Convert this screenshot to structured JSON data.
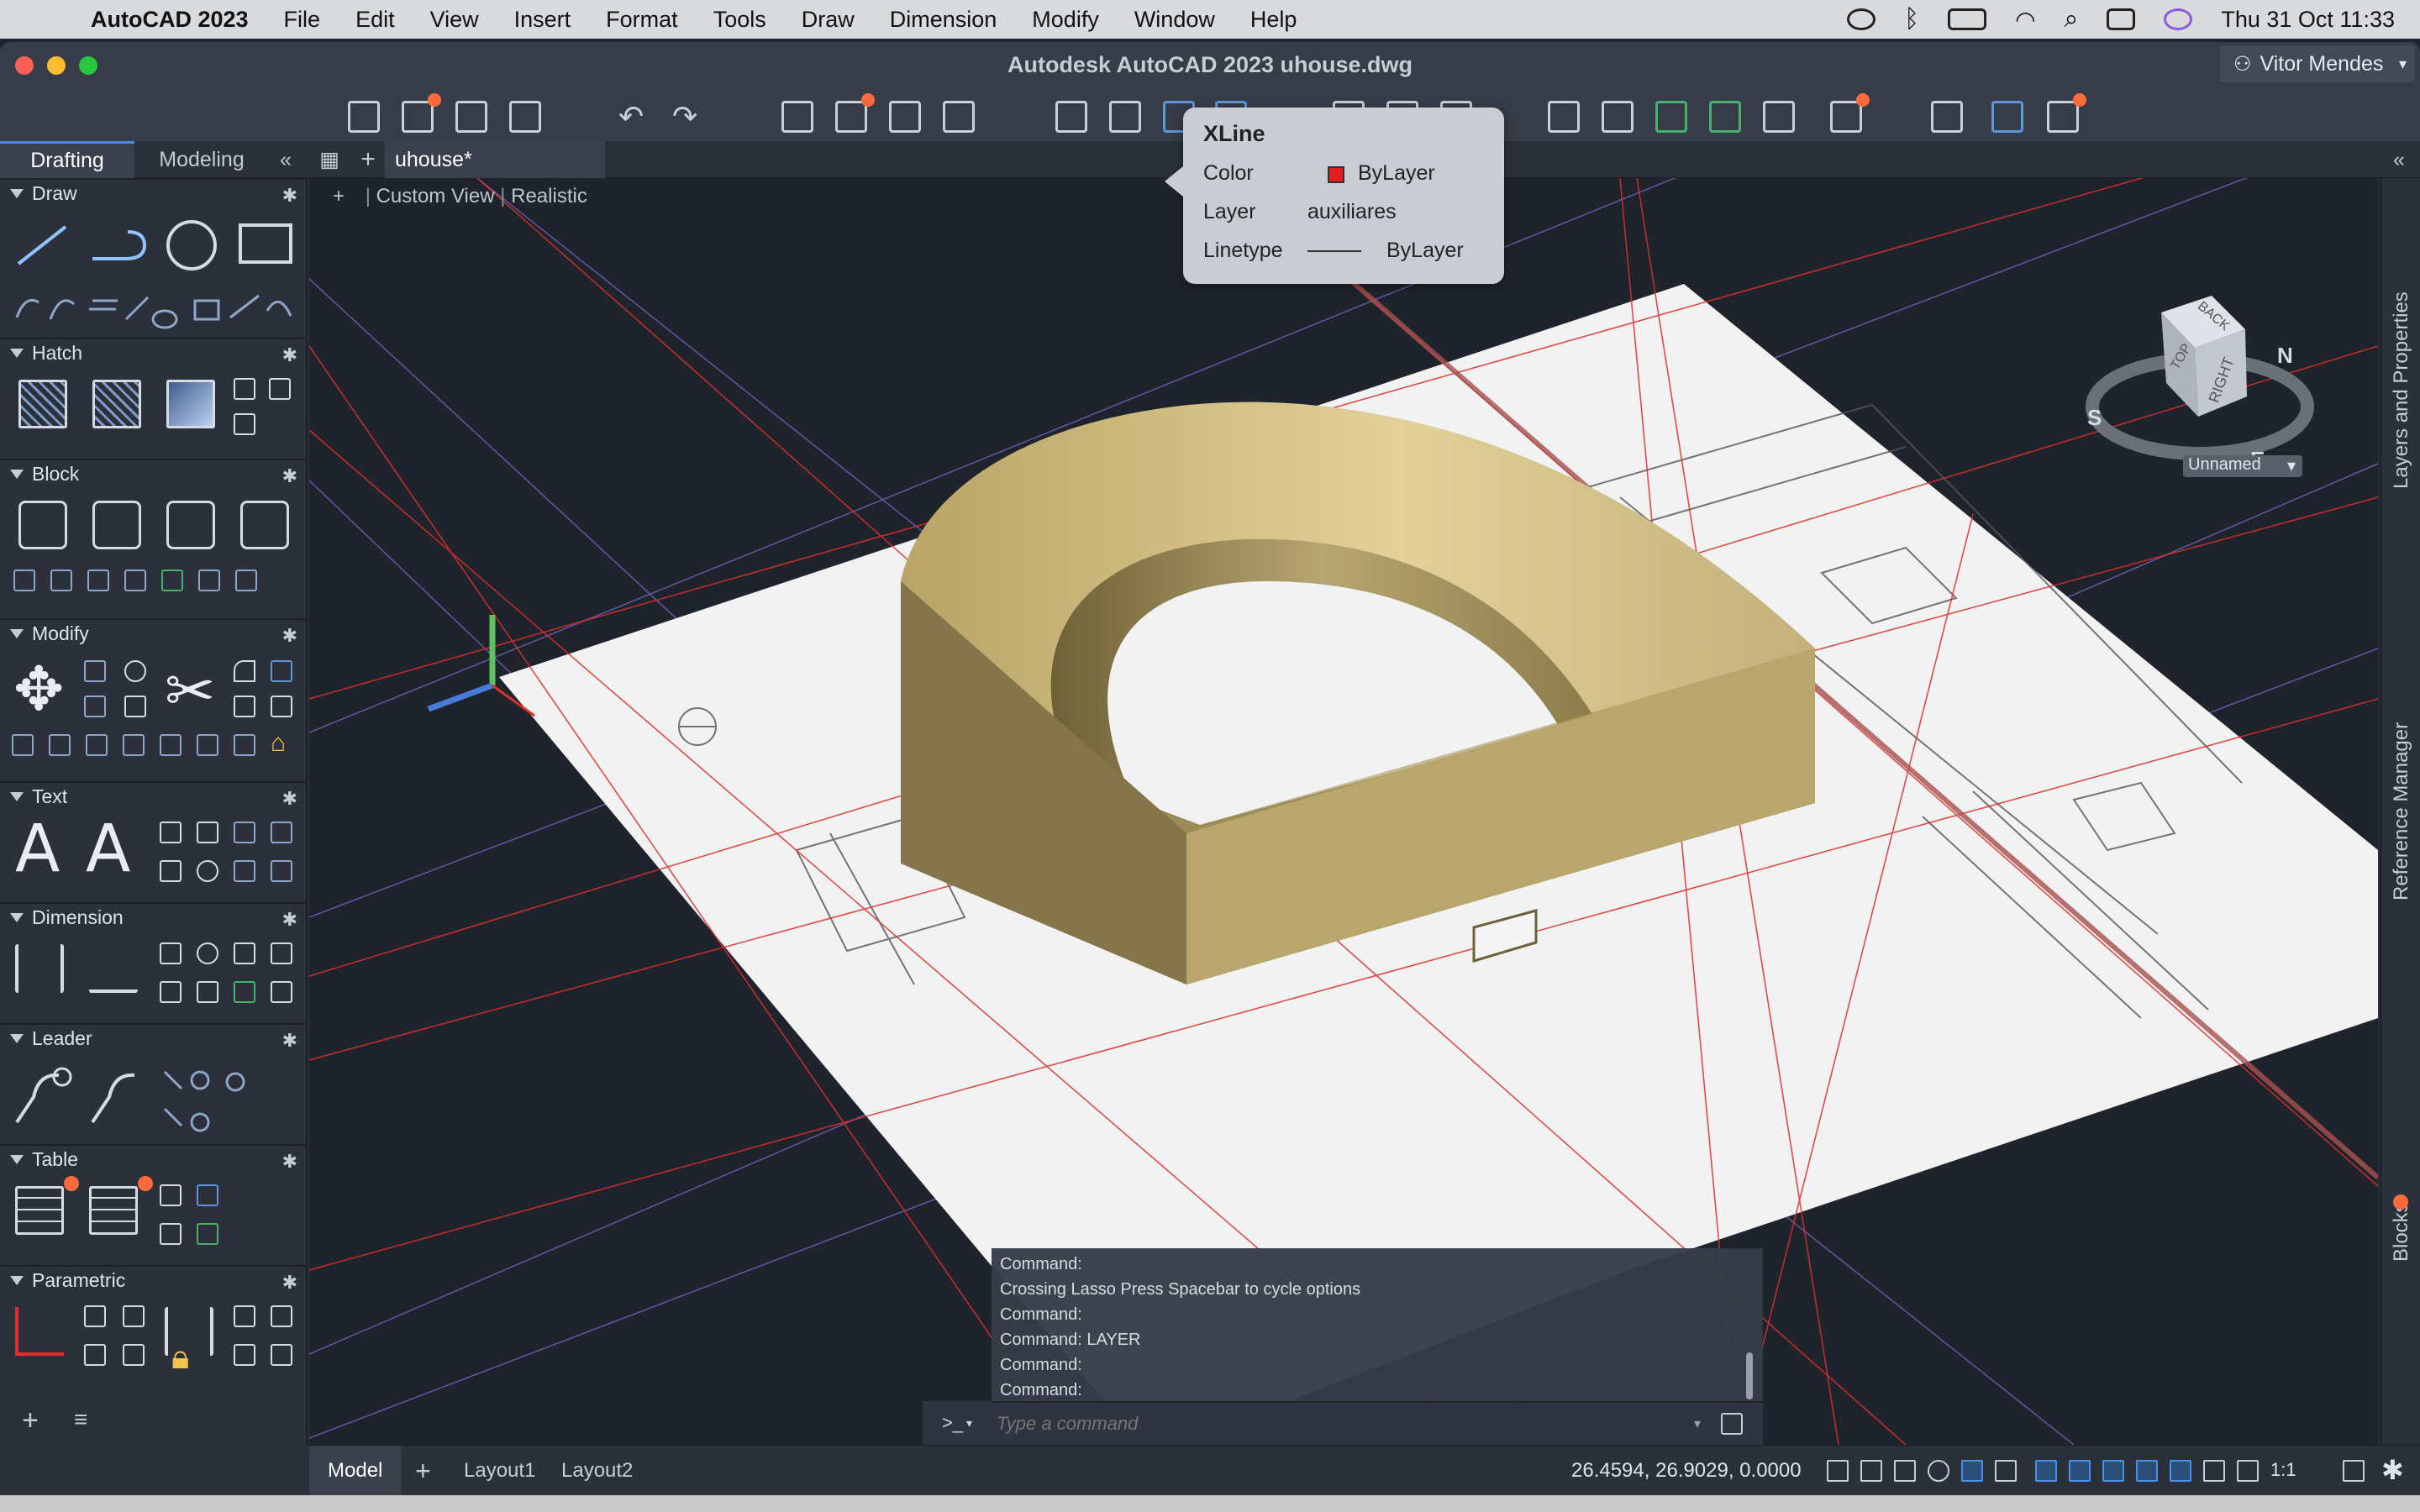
{
  "menubar": {
    "app_name": "AutoCAD 2023",
    "items": [
      "File",
      "Edit",
      "View",
      "Insert",
      "Format",
      "Tools",
      "Draw",
      "Dimension",
      "Modify",
      "Window",
      "Help"
    ],
    "datetime": "Thu 31 Oct  11:33"
  },
  "window": {
    "title": "Autodesk AutoCAD 2023    uhouse.dwg",
    "user": "Vitor Mendes"
  },
  "panel": {
    "tabs": [
      "Drafting",
      "Modeling"
    ],
    "sections": [
      "Draw",
      "Hatch",
      "Block",
      "Modify",
      "Text",
      "Dimension",
      "Leader",
      "Table",
      "Parametric"
    ]
  },
  "document": {
    "tab": "uhouse*"
  },
  "viewport": {
    "view_label": "Custom View",
    "style_label": "Realistic",
    "viewcube": {
      "faces": [
        "TOP",
        "RIGHT",
        "BACK"
      ],
      "compass": [
        "S",
        "N",
        "E"
      ],
      "named_view": "Unnamed"
    }
  },
  "tooltip": {
    "title": "XLine",
    "rows": [
      {
        "key": "Color",
        "value": "ByLayer"
      },
      {
        "key": "Layer",
        "value": "auxiliares"
      },
      {
        "key": "Linetype",
        "value": "ByLayer"
      }
    ],
    "color_swatch": "#e02020"
  },
  "right_strip": [
    "Layers and Properties",
    "Reference Manager",
    "Blocks"
  ],
  "command": {
    "history": [
      "Command:",
      "Crossing Lasso  Press Spacebar to cycle options",
      "Command:",
      "Command: LAYER",
      "Command:",
      "Command:"
    ],
    "placeholder": "Type a command",
    "prompt": ">_"
  },
  "status": {
    "tabs": [
      "Model",
      "Layout1",
      "Layout2"
    ],
    "coordinates": "26.4594, 26.9029, 0.0000",
    "scale": "1:1"
  },
  "colors": {
    "accent": "#4a90e2",
    "solid": "#c9b57a",
    "xline_red": "#d9302c",
    "xline_purple": "#8e6fd6"
  }
}
